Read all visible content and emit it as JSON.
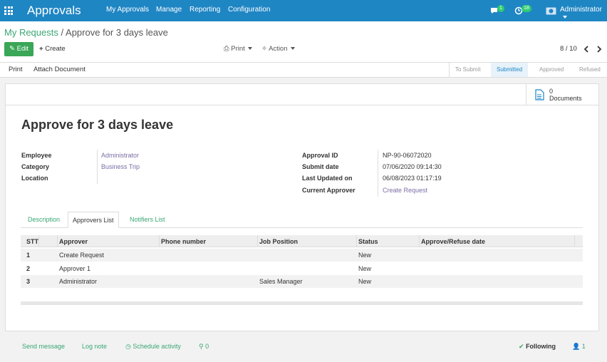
{
  "app": {
    "title": "Approvals",
    "menu": [
      "My Approvals",
      "Manage",
      "Reporting",
      "Configuration"
    ],
    "chat_count": "1",
    "activity_count": "18",
    "user": "Administrator"
  },
  "breadcrumb": {
    "parent": "My Requests",
    "separator": "/",
    "current": "Approve for 3 days leave"
  },
  "toolbar": {
    "edit": "Edit",
    "create": "Create",
    "print": "Print",
    "action": "Action",
    "pager": "8 / 10"
  },
  "statusbar": {
    "print": "Print",
    "attach": "Attach Document",
    "stages": [
      "To Submit",
      "Submitted",
      "Approved",
      "Refused"
    ],
    "active": "Submitted"
  },
  "docs": {
    "count": "0",
    "label": "Documents"
  },
  "form": {
    "title": "Approve for 3 days leave",
    "left": [
      {
        "label": "Employee",
        "value": "Administrator"
      },
      {
        "label": "Category",
        "value": "Business Trip"
      },
      {
        "label": "Location",
        "value": ""
      }
    ],
    "right": [
      {
        "label": "Approval ID",
        "value": "NP-90-06072020"
      },
      {
        "label": "Submit date",
        "value": "07/06/2020 09:14:30"
      },
      {
        "label": "Last Updated on",
        "value": "06/08/2023 01:17:19"
      },
      {
        "label": "Current Approver",
        "value": "Create Request"
      }
    ]
  },
  "tabs": [
    "Description",
    "Approvers List",
    "Notifiers List"
  ],
  "table": {
    "headers": [
      "STT",
      "Approver",
      "Phone number",
      "Job Position",
      "Status",
      "Approve/Refuse date"
    ],
    "rows": [
      [
        "1",
        "Create Request",
        "",
        "",
        "New",
        ""
      ],
      [
        "2",
        "Approver 1",
        "",
        "",
        "New",
        ""
      ],
      [
        "3",
        "Administrator",
        "",
        "Sales Manager",
        "New",
        ""
      ]
    ]
  },
  "chatter": {
    "send": "Send message",
    "log": "Log note",
    "schedule": "Schedule activity",
    "attachments": "0",
    "following": "Following",
    "followers": "1"
  }
}
